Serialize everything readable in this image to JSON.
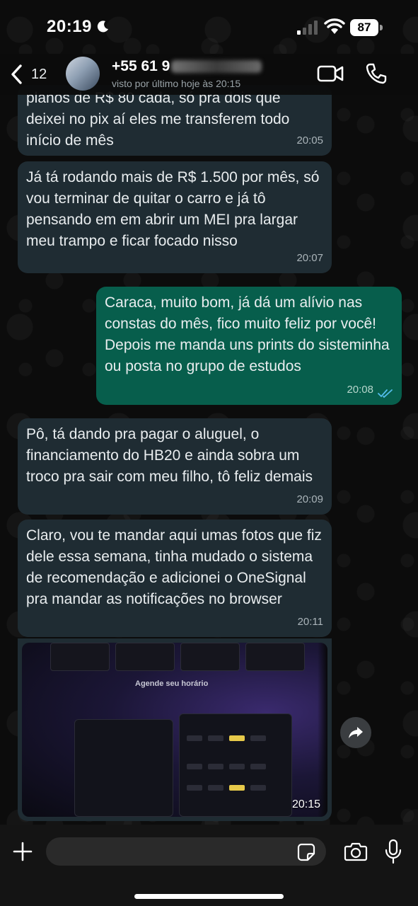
{
  "status_bar": {
    "time": "20:19",
    "battery": "87"
  },
  "header": {
    "back_count": "12",
    "contact_name": "+55 61 9",
    "last_seen": "visto por último hoje às 20:15"
  },
  "messages": [
    {
      "direction": "in",
      "text": "planos de R$ 80 cada, só pra dois que deixei no pix aí eles me transferem todo início de mês",
      "time": "20:05"
    },
    {
      "direction": "in",
      "text": "Já tá rodando mais de R$ 1.500 por mês, só vou terminar de quitar o carro e já tô pensando em em abrir um MEI pra largar meu trampo e ficar focado nisso",
      "time": "20:07"
    },
    {
      "direction": "out",
      "text": "Caraca, muito bom, já dá um alívio nas constas do mês, fico muito feliz por você! Depois me manda uns prints do sisteminha ou posta no grupo de estudos",
      "time": "20:08",
      "status": "read"
    },
    {
      "direction": "in",
      "text": "Pô, tá dando pra pagar o aluguel, o financiamento do HB20 e ainda sobra um troco pra sair com meu filho, tô feliz demais",
      "time": "20:09"
    },
    {
      "direction": "in",
      "text": "Claro, vou te mandar aqui umas fotos que fiz dele essa semana, tinha mudado o sistema de recomendação e adicionei o OneSignal pra mandar as notificações no browser",
      "time": "20:11"
    }
  ],
  "photo_message": {
    "time": "20:15",
    "screen_title": "Agende seu horário"
  },
  "composer": {
    "placeholder": ""
  },
  "colors": {
    "incoming_bubble": "#1f2c33",
    "outgoing_bubble": "#075e4c",
    "read_tick": "#53bdeb"
  }
}
